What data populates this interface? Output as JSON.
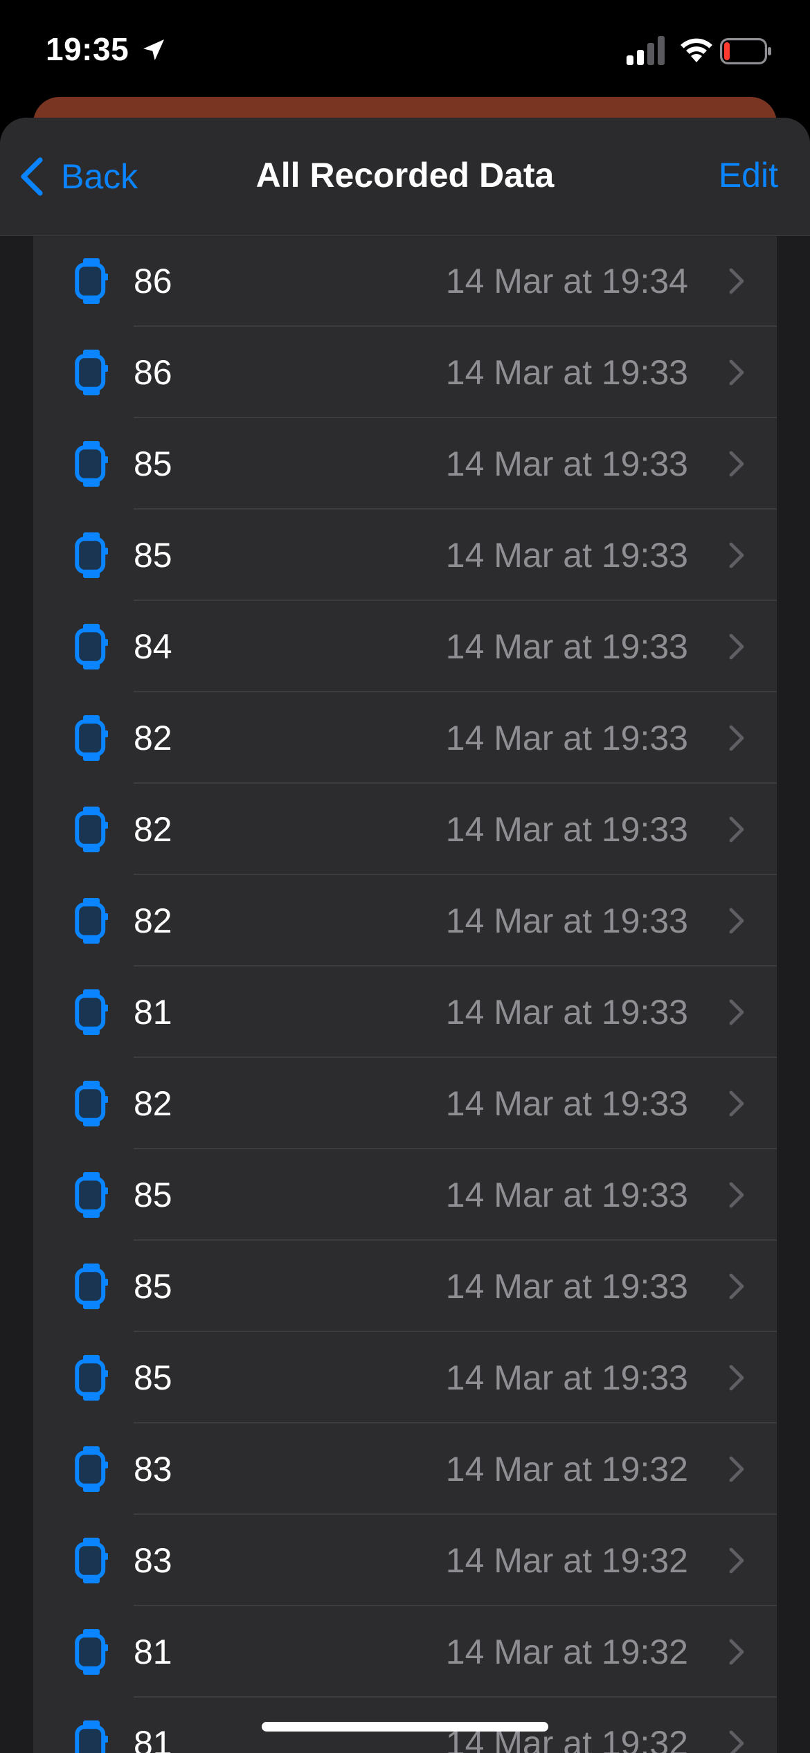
{
  "status_bar": {
    "time": "19:35",
    "location_icon": "location-arrow-icon",
    "signal_icon": "cellular-signal-icon",
    "wifi_icon": "wifi-icon",
    "battery_icon": "battery-low-icon",
    "battery_color": "#ff3b30"
  },
  "nav": {
    "back_label": "Back",
    "title": "All Recorded Data",
    "edit_label": "Edit",
    "accent": "#0a84ff"
  },
  "records": [
    {
      "value": "86",
      "date": "14 Mar at 19:34"
    },
    {
      "value": "86",
      "date": "14 Mar at 19:33"
    },
    {
      "value": "85",
      "date": "14 Mar at 19:33"
    },
    {
      "value": "85",
      "date": "14 Mar at 19:33"
    },
    {
      "value": "84",
      "date": "14 Mar at 19:33"
    },
    {
      "value": "82",
      "date": "14 Mar at 19:33"
    },
    {
      "value": "82",
      "date": "14 Mar at 19:33"
    },
    {
      "value": "82",
      "date": "14 Mar at 19:33"
    },
    {
      "value": "81",
      "date": "14 Mar at 19:33"
    },
    {
      "value": "82",
      "date": "14 Mar at 19:33"
    },
    {
      "value": "85",
      "date": "14 Mar at 19:33"
    },
    {
      "value": "85",
      "date": "14 Mar at 19:33"
    },
    {
      "value": "85",
      "date": "14 Mar at 19:33"
    },
    {
      "value": "83",
      "date": "14 Mar at 19:32"
    },
    {
      "value": "83",
      "date": "14 Mar at 19:32"
    },
    {
      "value": "81",
      "date": "14 Mar at 19:32"
    },
    {
      "value": "81",
      "date": "14 Mar at 19:32"
    }
  ],
  "row_icon": "apple-watch-icon",
  "row_chevron": "chevron-right-icon"
}
